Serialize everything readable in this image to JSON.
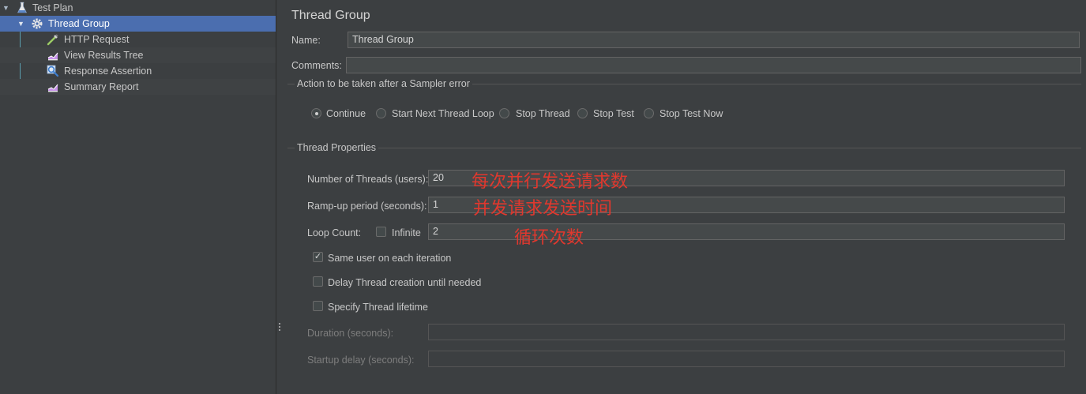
{
  "tree": {
    "items": [
      {
        "label": "Test Plan",
        "icon": "flask-icon"
      },
      {
        "label": "Thread Group",
        "icon": "gear-icon",
        "selected": true
      },
      {
        "label": "HTTP Request",
        "icon": "pipette-icon"
      },
      {
        "label": "View Results Tree",
        "icon": "chart-icon"
      },
      {
        "label": "Response Assertion",
        "icon": "magnifier-icon"
      },
      {
        "label": "Summary Report",
        "icon": "chart-icon"
      }
    ]
  },
  "panel": {
    "title": "Thread Group",
    "name_label": "Name:",
    "name_value": "Thread Group",
    "comments_label": "Comments:",
    "comments_value": ""
  },
  "sampler_error": {
    "legend": "Action to be taken after a Sampler error",
    "options": [
      "Continue",
      "Start Next Thread Loop",
      "Stop Thread",
      "Stop Test",
      "Stop Test Now"
    ],
    "selected": "Continue"
  },
  "thread_props": {
    "legend": "Thread Properties",
    "threads_label": "Number of Threads (users):",
    "threads_value": "20",
    "rampup_label": "Ramp-up period (seconds):",
    "rampup_value": "1",
    "loop_label": "Loop Count:",
    "infinite_label": "Infinite",
    "infinite_checked": false,
    "loop_value": "2",
    "same_user_label": "Same user on each iteration",
    "same_user_checked": true,
    "delay_label": "Delay Thread creation until needed",
    "delay_checked": false,
    "lifetime_label": "Specify Thread lifetime",
    "lifetime_checked": false,
    "duration_label": "Duration (seconds):",
    "duration_value": "",
    "startup_label": "Startup delay (seconds):",
    "startup_value": ""
  },
  "annotations": {
    "threads": "每次并行发送请求数",
    "rampup": "并发请求发送时间",
    "loop": "循环次数"
  },
  "colors": {
    "background": "#3c3f41",
    "selection": "#4b6eaf",
    "annotation": "#e0382e"
  }
}
